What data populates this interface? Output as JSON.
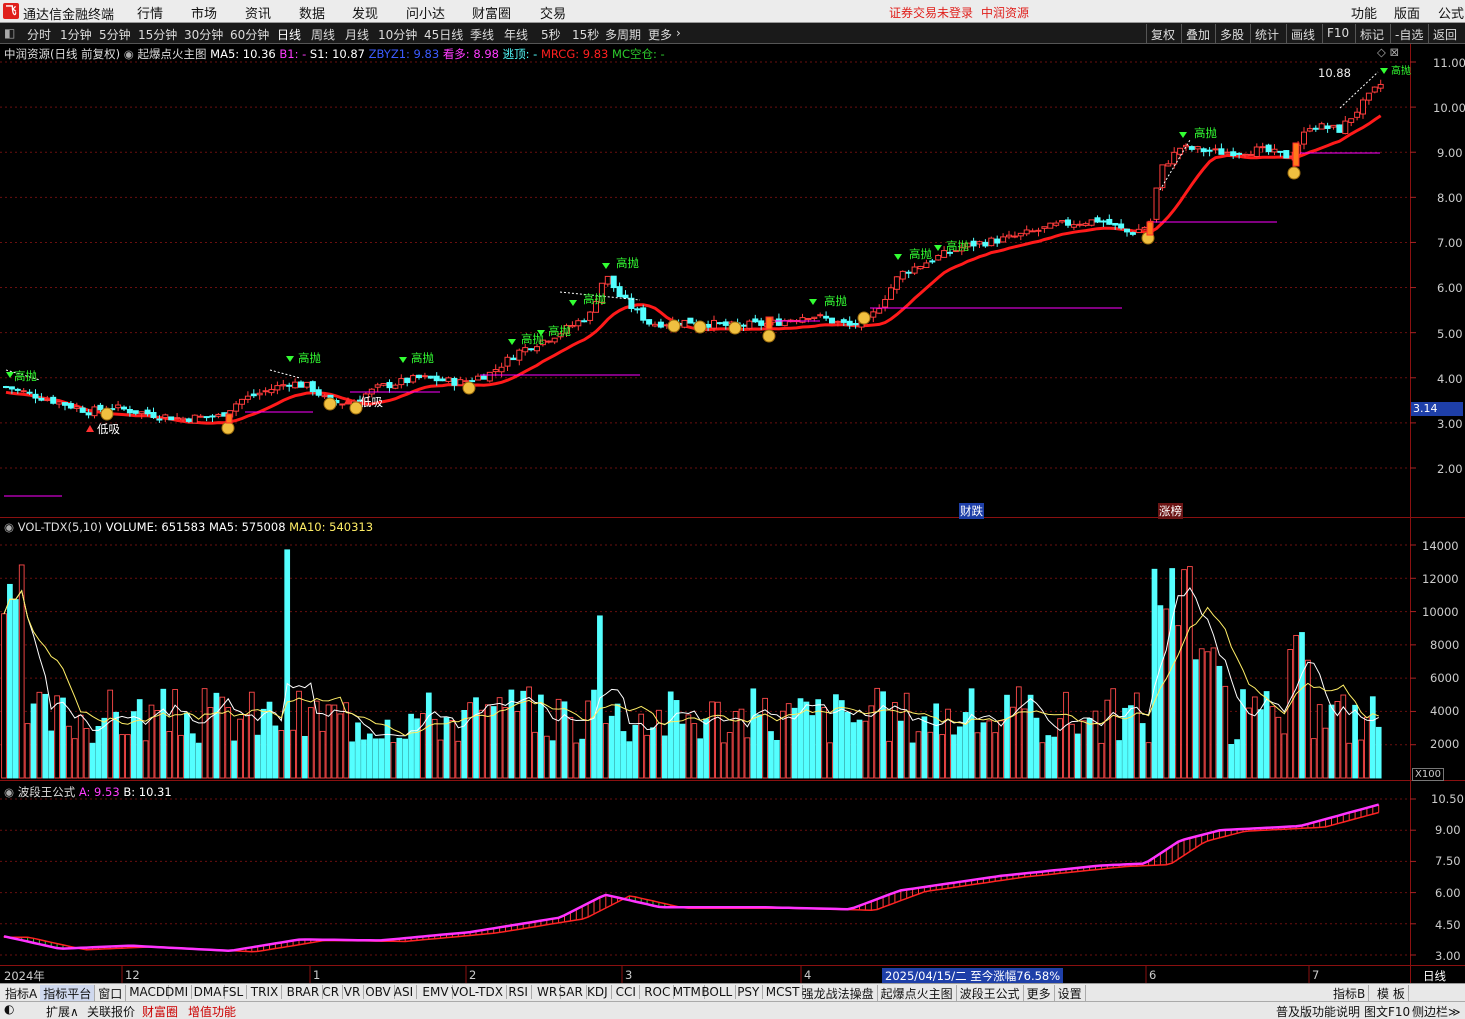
{
  "app": {
    "title": "通达信金融终端",
    "menu": [
      "行情",
      "市场",
      "资讯",
      "数据",
      "发现",
      "问小达",
      "财富圈",
      "交易"
    ],
    "status_warning": "证券交易未登录",
    "broker": "中润资源",
    "right_menu": [
      "功能",
      "版面",
      "公式"
    ]
  },
  "periods": {
    "items": [
      "分时",
      "1分钟",
      "5分钟",
      "15分钟",
      "30分钟",
      "60分钟",
      "日线",
      "周线",
      "月线",
      "10分钟",
      "45日线",
      "季线",
      "年线",
      "5秒",
      "15秒",
      "多周期",
      "更多"
    ],
    "active": "日线",
    "right_buttons": [
      "复权",
      "叠加",
      "多股",
      "统计",
      "画线",
      "F10",
      "标记",
      "-自选",
      "返回"
    ]
  },
  "main_panel": {
    "stock_label": "中润资源(日线 前复权)",
    "formula": "起爆点火主图",
    "ma5": "MA5: 10.36",
    "b1": "B1: -",
    "s1": "S1: 10.87",
    "zbyz1": "ZBYZ1: 9.83",
    "kanduo": "看多: 8.98",
    "taoding": "逃顶: -",
    "mrcg": "MRCG: 9.83",
    "mckc": "MC空仓: -",
    "price_ticks": [
      "11.00",
      "10.00",
      "9.00",
      "8.00",
      "7.00",
      "6.00",
      "5.00",
      "4.00",
      "3.00",
      "2.00"
    ],
    "last_price": "3.14",
    "max_label": "10.88",
    "sell_label": "高抛",
    "buy_label": "低吸",
    "event1": "财跌",
    "event2": "涨榜"
  },
  "vol_panel": {
    "name": "VOL-TDX(5,10)",
    "volume": "VOLUME: 651583",
    "ma5": "MA5: 575008",
    "ma10": "MA10: 540313",
    "ticks": [
      "14000",
      "12000",
      "10000",
      "8000",
      "6000",
      "4000",
      "2000"
    ],
    "unit": "X100"
  },
  "wave_panel": {
    "name": "波段王公式",
    "a": "A: 9.53",
    "b": "B: 10.31",
    "ticks": [
      "10.50",
      "9.00",
      "7.50",
      "6.00",
      "4.50",
      "3.00"
    ]
  },
  "date_axis": {
    "labels": [
      "2024年",
      "12",
      "1",
      "2",
      "3",
      "4",
      "6",
      "7"
    ],
    "highlight": "2025/04/15/二  至今涨幅76.58%",
    "period": "日线"
  },
  "tabs": {
    "items": [
      "指标A",
      "指标平台",
      "窗口",
      "MACD",
      "DMI",
      "DMA",
      "FSL",
      "TRIX",
      "BRAR",
      "CR",
      "VR",
      "OBV",
      "ASI",
      "EMV",
      "VOL-TDX",
      "RSI",
      "WR",
      "SAR",
      "KDJ",
      "CCI",
      "ROC",
      "MTM",
      "BOLL",
      "PSY",
      "MCST",
      "强龙战法操盘",
      "起爆点火主图",
      "波段王公式",
      "更多",
      "设置"
    ],
    "right": [
      "指标B",
      "模 板"
    ]
  },
  "statusbar": {
    "items": [
      "扩展∧",
      "关联报价",
      "财富圈",
      "增值功能"
    ],
    "right": [
      "普及版功能说明",
      "图文F10",
      "侧边栏≫"
    ]
  },
  "colors": {
    "up": "#ff3c3c",
    "down": "#54ffff",
    "ma_red": "#ff1a1a",
    "grid": "#6a0f0f",
    "magenta": "#ff00ff"
  }
}
